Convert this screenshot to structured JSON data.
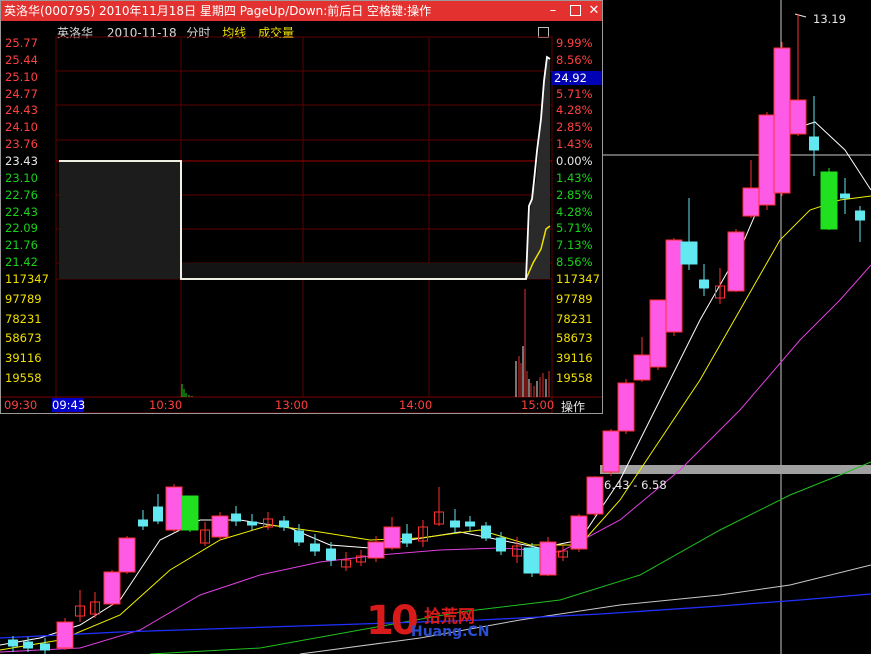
{
  "window": {
    "title": "英洛华(000795) 2010年11月18日 星期四 PageUp/Down:前后日 空格键:操作",
    "min_glyph": "–",
    "close_glyph": "✕"
  },
  "info_bar": {
    "name": "英洛华",
    "date": "2010-11-18",
    "period": "分时",
    "avg_label": "均线",
    "vol_label": "成交量"
  },
  "price_axis_left": [
    {
      "v": "25.77",
      "c": "red"
    },
    {
      "v": "25.44",
      "c": "red"
    },
    {
      "v": "25.10",
      "c": "red"
    },
    {
      "v": "24.77",
      "c": "red"
    },
    {
      "v": "24.43",
      "c": "red"
    },
    {
      "v": "24.10",
      "c": "red"
    },
    {
      "v": "23.76",
      "c": "red"
    },
    {
      "v": "23.43",
      "c": "white"
    },
    {
      "v": "23.10",
      "c": "green"
    },
    {
      "v": "22.76",
      "c": "green"
    },
    {
      "v": "22.43",
      "c": "green"
    },
    {
      "v": "22.09",
      "c": "green"
    },
    {
      "v": "21.76",
      "c": "green"
    },
    {
      "v": "21.42",
      "c": "green"
    }
  ],
  "pct_axis_right": [
    {
      "v": "9.99%",
      "c": "red"
    },
    {
      "v": "8.56%",
      "c": "red"
    },
    {
      "v": "7.13%",
      "c": "red"
    },
    {
      "v": "5.71%",
      "c": "red"
    },
    {
      "v": "4.28%",
      "c": "red"
    },
    {
      "v": "2.85%",
      "c": "red"
    },
    {
      "v": "1.43%",
      "c": "red"
    },
    {
      "v": "0.00%",
      "c": "white"
    },
    {
      "v": "1.43%",
      "c": "green"
    },
    {
      "v": "2.85%",
      "c": "green"
    },
    {
      "v": "4.28%",
      "c": "green"
    },
    {
      "v": "5.71%",
      "c": "green"
    },
    {
      "v": "7.13%",
      "c": "green"
    },
    {
      "v": "8.56%",
      "c": "green"
    }
  ],
  "current_price": "24.92",
  "volume_axis": [
    "117347",
    "97789",
    "78231",
    "58673",
    "39116",
    "19558"
  ],
  "time_axis": {
    "labels": [
      "09:30",
      "10:30",
      "13:00",
      "14:00",
      "15:00"
    ],
    "cursor": "09:43",
    "operate": "操作"
  },
  "kline": {
    "high_label": "13.19",
    "range_label": "6.43 - 6.58"
  },
  "watermark": {
    "ten": "10",
    "cn": "拾荒网",
    "en": "Huang.CN"
  },
  "colors": {
    "up": "#ff3030",
    "up_fill": "#ff5ae6",
    "down": "#62e8f0",
    "down_fill": "#20e020",
    "price_line": "#ffffff",
    "avg_line": "#f0e000",
    "title_bar": "#e2312f"
  }
}
